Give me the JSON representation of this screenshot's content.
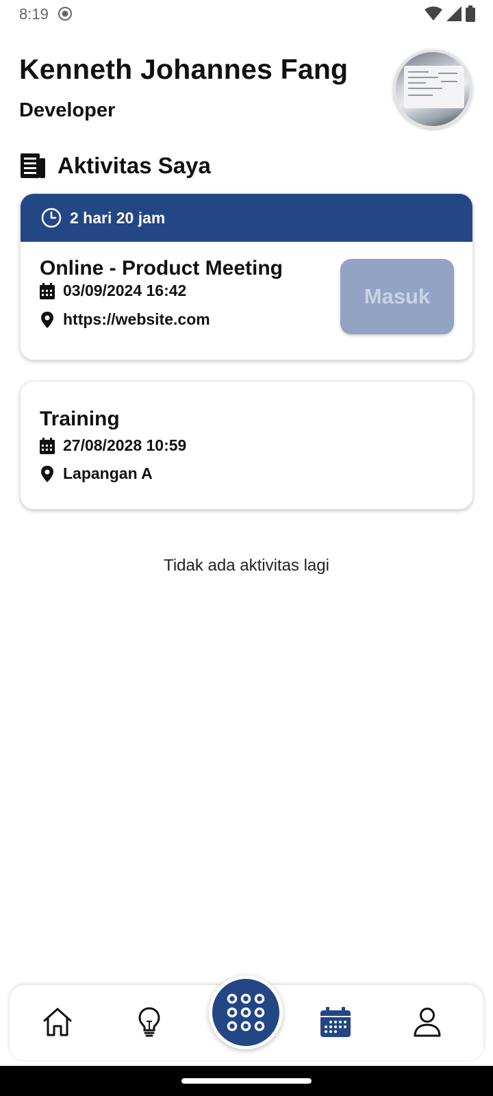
{
  "status_bar": {
    "time": "8:19"
  },
  "profile": {
    "name": "Kenneth Johannes Fang",
    "role": "Developer"
  },
  "section": {
    "title": "Aktivitas Saya"
  },
  "activities": [
    {
      "countdown": "2 hari  20 jam",
      "title": "Online - Product Meeting",
      "datetime": "03/09/2024  16:42",
      "location": "https://website.com",
      "action_label": "Masuk"
    },
    {
      "title": "Training",
      "datetime": "27/08/2028  10:59",
      "location": "Lapangan A"
    }
  ],
  "empty_message": "Tidak ada aktivitas lagi",
  "bottom_nav": {
    "items": [
      {
        "icon": "home-icon"
      },
      {
        "icon": "lightbulb-icon"
      },
      {
        "icon": "apps-grid-icon"
      },
      {
        "icon": "calendar-icon",
        "active": true
      },
      {
        "icon": "person-icon"
      }
    ]
  },
  "colors": {
    "primary": "#234685",
    "button_disabled": "#92a3c4"
  }
}
